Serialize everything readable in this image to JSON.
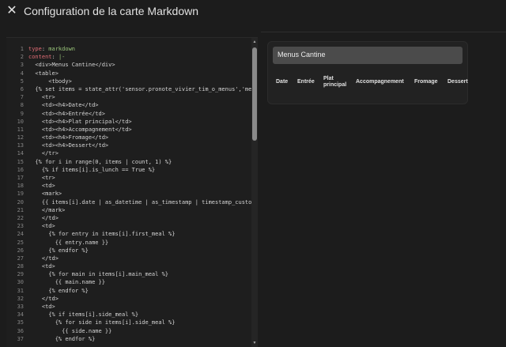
{
  "dialog": {
    "title": "Configuration de la carte Markdown",
    "close_icon": "close-icon"
  },
  "editor": {
    "lines": [
      "type: markdown",
      "content: |-",
      "  <div>Menus Cantine</div>",
      "  <table>",
      "      <tbody>",
      "  {% set items = state_attr('sensor.pronote_vivier_tim_o_menus','menus') %}",
      "    <tr>",
      "    <td><h4>Date</td>",
      "    <td><h4>Entrée</td>",
      "    <td><h4>Plat principal</td>",
      "    <td><h4>Accompagnement</td>",
      "    <td><h4>Fromage</td>",
      "    <td><h4>Dessert</td>",
      "    </tr>",
      "  {% for i in range(0, items | count, 1) %}",
      "    {% if items[i].is_lunch == True %}",
      "    <tr>",
      "    <td>",
      "    <mark>",
      "    {{ items[i].date | as_datetime | as_timestamp | timestamp_custom('%d/%m') }}",
      "    </mark>",
      "    </td>",
      "    <td>",
      "      {% for entry in items[i].first_meal %}",
      "        {{ entry.name }}",
      "      {% endfor %}",
      "    </td>",
      "    <td>",
      "      {% for main in items[i].main_meal %}",
      "        {{ main.name }}",
      "      {% endfor %}",
      "    </td>",
      "    <td>",
      "      {% if items[i].side_meal %}",
      "        {% for side in items[i].side_meal %}",
      "          {{ side.name }}",
      "        {% endfor %}"
    ]
  },
  "preview": {
    "header": "Menus Cantine",
    "columns": [
      "Date",
      "Entrée",
      "Plat principal",
      "Accompagnement",
      "Fromage",
      "Dessert"
    ]
  }
}
